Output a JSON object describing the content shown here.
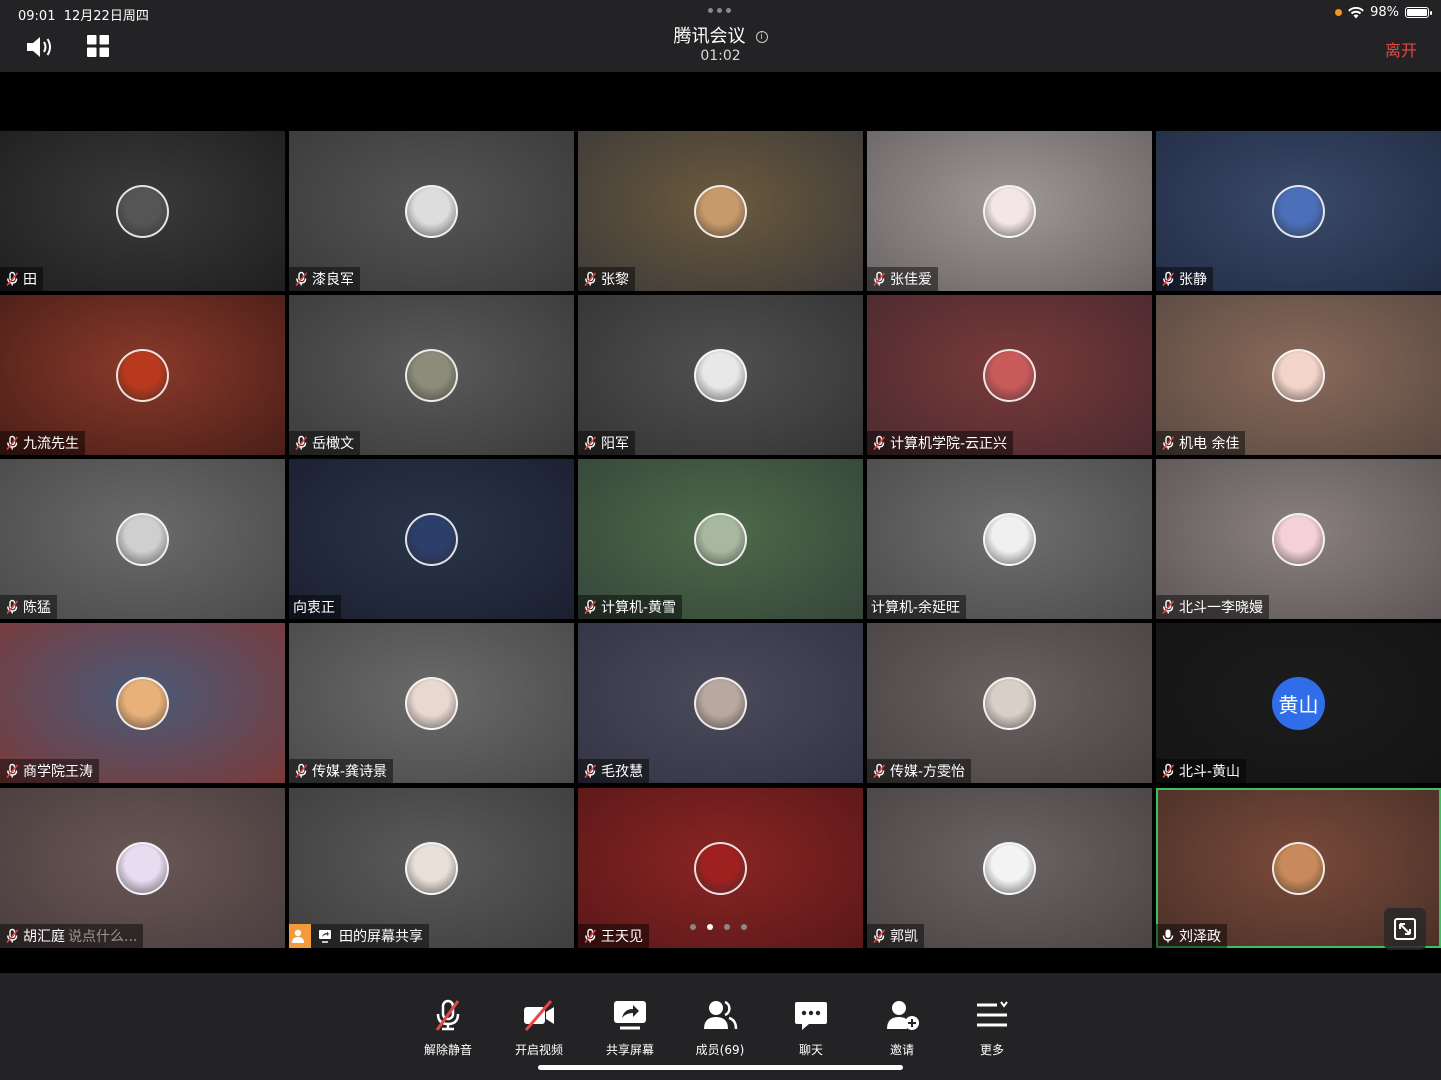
{
  "status": {
    "time": "09:01",
    "date": "12月22日周四",
    "battery": "98%",
    "battery_level": 0.98
  },
  "header": {
    "title": "腾讯会议",
    "timer": "01:02",
    "leave_label": "离开",
    "info_icon": "info-icon",
    "speaker_icon": "speaker-icon",
    "layout_icon": "grid-layout-icon"
  },
  "participants": [
    {
      "name": "田",
      "mic": "muted",
      "bg": [
        "#3a3a3a",
        "#1f1f1f"
      ],
      "avatar_color": "#555"
    },
    {
      "name": "漆良军",
      "mic": "muted",
      "bg": [
        "#555555",
        "#3a3a3a"
      ],
      "avatar_color": "#ddd"
    },
    {
      "name": "张黎",
      "mic": "muted",
      "bg": [
        "#6b5a3c",
        "#3d3a3a"
      ],
      "avatar_color": "#c89a6a"
    },
    {
      "name": "张佳爱",
      "mic": "muted",
      "bg": [
        "#a09898",
        "#6a6464"
      ],
      "avatar_color": "#f4e6e6"
    },
    {
      "name": "张静",
      "mic": "muted",
      "bg": [
        "#3a4a6a",
        "#232d45"
      ],
      "avatar_color": "#4b6fb8"
    },
    {
      "name": "九流先生",
      "mic": "muted",
      "bg": [
        "#8a3a2a",
        "#4a1e18"
      ],
      "avatar_color": "#b8391e"
    },
    {
      "name": "岳橄文",
      "mic": "muted",
      "bg": [
        "#5a5a5a",
        "#3b3b3b"
      ],
      "avatar_color": "#8c8c7a"
    },
    {
      "name": "阳军",
      "mic": "muted",
      "bg": [
        "#505050",
        "#343434"
      ],
      "avatar_color": "#e8e8e8"
    },
    {
      "name": "计算机学院-云正兴",
      "mic": "muted",
      "bg": [
        "#7a3a3a",
        "#4a2a30"
      ],
      "avatar_color": "#c85a5a"
    },
    {
      "name": "机电 余佳",
      "mic": "muted",
      "bg": [
        "#8a6a5a",
        "#5a4a42"
      ],
      "avatar_color": "#f3d4c8"
    },
    {
      "name": "陈猛",
      "mic": "muted",
      "bg": [
        "#6a6a6a",
        "#4a4a4a"
      ],
      "avatar_color": "#cfcfcf"
    },
    {
      "name": "向衷正",
      "mic": "none",
      "bg": [
        "#2a3448",
        "#1b2030"
      ],
      "avatar_color": "#2c3e6a"
    },
    {
      "name": "计算机-黄雪",
      "mic": "muted",
      "bg": [
        "#4e6a4a",
        "#36463a"
      ],
      "avatar_color": "#a8b8a0"
    },
    {
      "name": "计算机-余延旺",
      "mic": "none",
      "bg": [
        "#6e6e6e",
        "#4c4c4c"
      ],
      "avatar_color": "#f0f0f0"
    },
    {
      "name": "北斗一李晓嫚",
      "mic": "muted",
      "bg": [
        "#8a8080",
        "#5e5656"
      ],
      "avatar_color": "#f4d0d8"
    },
    {
      "name": "商学院王涛",
      "mic": "muted",
      "bg": [
        "#4a5a78",
        "#7a3a3a"
      ],
      "avatar_color": "#e8b07a"
    },
    {
      "name": "传媒-龚诗景",
      "mic": "muted",
      "bg": [
        "#6a6a6a",
        "#4a4a4a"
      ],
      "avatar_color": "#e8d8d0"
    },
    {
      "name": "毛孜慧",
      "mic": "muted",
      "bg": [
        "#4a4a5a",
        "#343444"
      ],
      "avatar_color": "#b8a8a0"
    },
    {
      "name": "传媒-方雯怡",
      "mic": "muted",
      "bg": [
        "#6a6060",
        "#4a4444"
      ],
      "avatar_color": "#d8d0c8"
    },
    {
      "name": "北斗-黄山",
      "mic": "muted",
      "bg": [
        "#1c1c1c",
        "#141414"
      ],
      "avatar_text": "黄山"
    },
    {
      "name": "胡汇庭",
      "mic": "muted",
      "chat_overlay": "说点什么...",
      "bg": [
        "#6a5656",
        "#4a3e3e"
      ],
      "avatar_color": "#e8dcf0"
    },
    {
      "name": "田的屏幕共享",
      "mic": "screen-share",
      "bg": [
        "#5a5a5a",
        "#3e3e3e"
      ],
      "avatar_color": "#e8e0d8"
    },
    {
      "name": "王天见",
      "mic": "muted",
      "bg": [
        "#8a2424",
        "#5a1818"
      ],
      "avatar_color": "#a02020"
    },
    {
      "name": "郭凯",
      "mic": "muted",
      "bg": [
        "#6a6464",
        "#4a4444"
      ],
      "avatar_color": "#f4f4f4"
    },
    {
      "name": "刘泽政",
      "mic": "active",
      "active": true,
      "bg": [
        "#7a4a3a",
        "#4a3028"
      ],
      "avatar_color": "#c88a5a"
    }
  ],
  "pager": {
    "page_count": 4,
    "current_page": 2
  },
  "fullscreen_icon": "fullscreen-icon",
  "toolbar": {
    "items": [
      {
        "label": "解除静音",
        "icon": "mic-muted-icon"
      },
      {
        "label": "开启视频",
        "icon": "video-off-icon"
      },
      {
        "label": "共享屏幕",
        "icon": "share-screen-icon"
      },
      {
        "label": "成员(69)",
        "icon": "members-icon"
      },
      {
        "label": "聊天",
        "icon": "chat-icon"
      },
      {
        "label": "邀请",
        "icon": "invite-icon"
      },
      {
        "label": "更多",
        "icon": "more-icon"
      }
    ]
  },
  "colors": {
    "leave": "#e84545",
    "active_border": "#3fbf5e",
    "share_badge": "#f29b38",
    "text_avatar": "#2f6ee8"
  }
}
